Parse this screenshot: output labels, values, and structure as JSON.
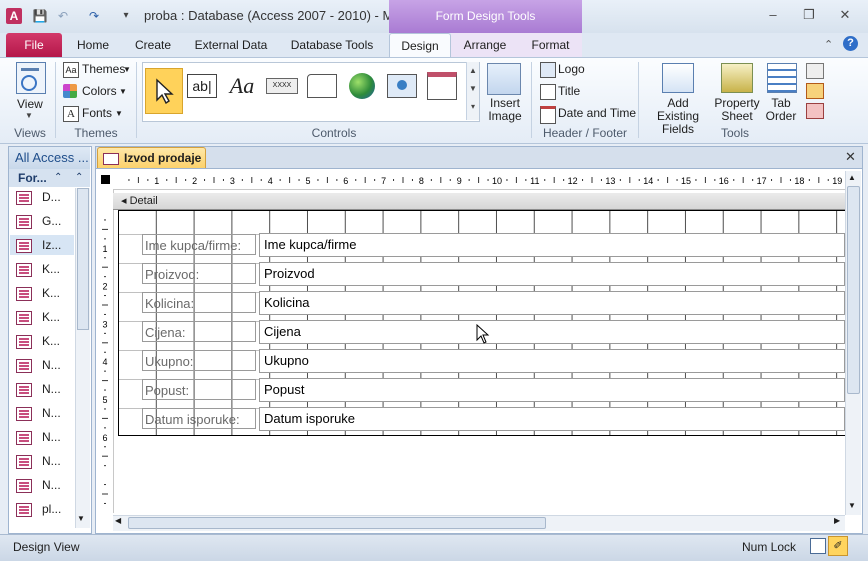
{
  "window": {
    "title": "proba : Database (Access 2007 - 2010)  -  M...",
    "context_tab_title": "Form Design Tools",
    "qat_icons": [
      "access-logo-icon",
      "save-icon",
      "undo-icon",
      "redo-icon",
      "customize-qat-icon"
    ]
  },
  "tabs": {
    "file": "File",
    "home": "Home",
    "create": "Create",
    "external": "External Data",
    "dbtools": "Database Tools",
    "design": "Design",
    "arrange": "Arrange",
    "format": "Format"
  },
  "ribbon": {
    "views": {
      "view_label": "View",
      "group": "Views"
    },
    "themes": {
      "themes": "Themes",
      "colors": "Colors",
      "fonts": "Fonts",
      "group": "Themes"
    },
    "controls": {
      "group": "Controls",
      "insert_image": "Insert Image"
    },
    "header_footer": {
      "logo": "Logo",
      "title": "Title",
      "date_time": "Date and Time",
      "group": "Header / Footer"
    },
    "tools": {
      "add_fields": "Add Existing Fields",
      "property_sheet": "Property Sheet",
      "tab_order": "Tab Order",
      "group": "Tools"
    }
  },
  "nav": {
    "header": "All Access ...",
    "subheader": "For...",
    "items": [
      "D...",
      "G...",
      "Iz...",
      "K...",
      "K...",
      "K...",
      "K...",
      "N...",
      "N...",
      "N...",
      "N...",
      "N...",
      "N...",
      "pl..."
    ]
  },
  "document": {
    "tab_label": "Izvod prodaje",
    "section": "Detail",
    "ruler_numbers": [
      "1",
      "2",
      "3",
      "4",
      "5",
      "6",
      "7",
      "8",
      "9",
      "10",
      "11",
      "12",
      "13",
      "14",
      "15",
      "16",
      "17",
      "18",
      "19"
    ],
    "vruler_numbers": [
      "1",
      "2",
      "3",
      "4",
      "5",
      "6"
    ],
    "fields": [
      {
        "label": "Ime kupca/firme:",
        "control": "Ime kupca/firme"
      },
      {
        "label": "Proizvod:",
        "control": "Proizvod"
      },
      {
        "label": "Kolicina:",
        "control": "Kolicina"
      },
      {
        "label": "Cijena:",
        "control": "Cijena"
      },
      {
        "label": "Ukupno:",
        "control": "Ukupno"
      },
      {
        "label": "Popust:",
        "control": "Popust"
      },
      {
        "label": "Datum isporuke:",
        "control": "Datum isporuke"
      }
    ]
  },
  "status": {
    "left": "Design View",
    "numlock": "Num Lock"
  },
  "colors": {
    "file_tab": "#b4174a",
    "context_tab": "#a97bd3",
    "doc_tab": "#fbd068"
  }
}
